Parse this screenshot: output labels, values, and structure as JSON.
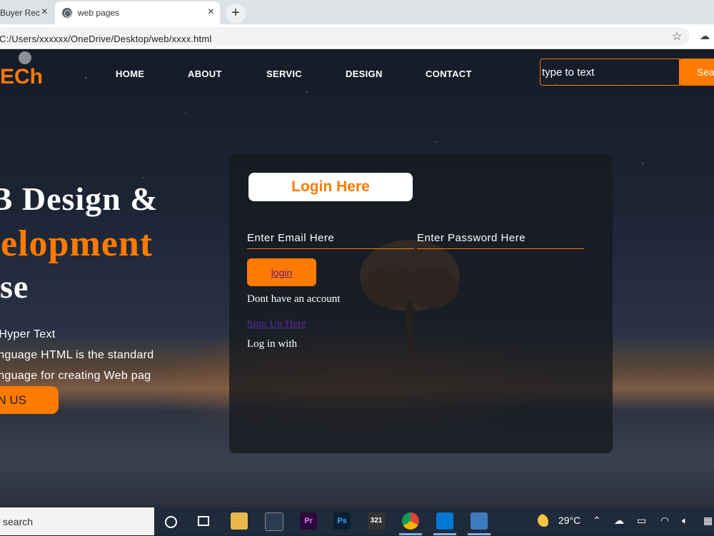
{
  "browser": {
    "tabs": [
      {
        "label": "Buyer Rec"
      },
      {
        "label": "web pages"
      }
    ],
    "new_tab": "+",
    "close": "×",
    "address": "C:/Users/xxxxxx/OneDrive/Desktop/web/xxxx.html"
  },
  "site": {
    "logo": "ECh",
    "nav": [
      "HOME",
      "ABOUT",
      "SERVIC",
      "DESIGN",
      "CONTACT"
    ],
    "search": {
      "placeholder": "type to text",
      "button": "Sea"
    },
    "hero": {
      "line1": "EB Design &",
      "line2": "velopment",
      "line3": "urse",
      "paragraph": [
        "r Hyper Text",
        "anguage HTML is the standard",
        "anguage for creating Web pag"
      ],
      "button": "N US"
    },
    "login": {
      "title": "Login Here",
      "email_placeholder": "Enter Email Here",
      "password_placeholder": "Enter Password Here",
      "button": "login",
      "no_account": "Dont have an account",
      "signup": "Sign Up Here",
      "login_with": "Log in with"
    }
  },
  "taskbar": {
    "search": "search",
    "apps": [
      "File Explorer",
      "Store",
      "Pr",
      "Ps",
      "321",
      "Chrome",
      "VS Code",
      "Photos"
    ],
    "temperature": "29°C"
  },
  "colors": {
    "accent": "#ff7a00",
    "taskbar": "#1f2a3a"
  }
}
